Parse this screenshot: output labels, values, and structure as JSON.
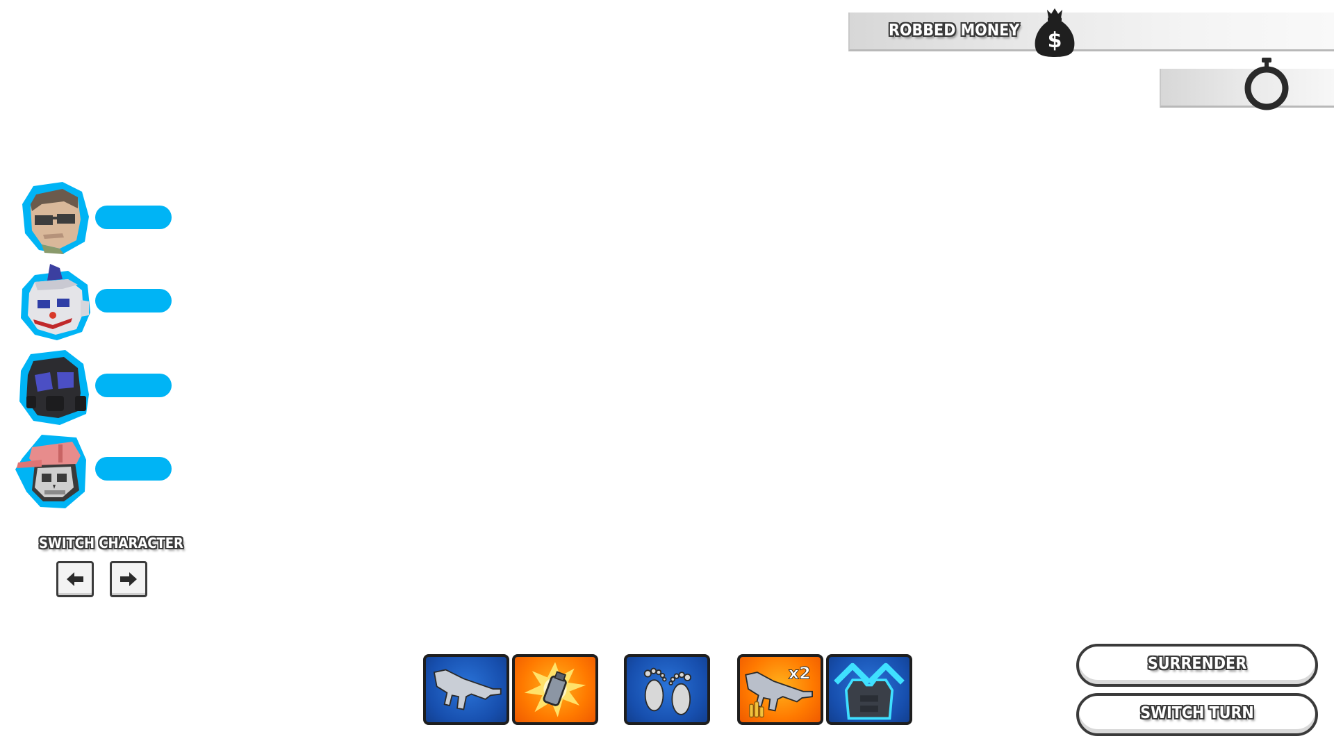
{
  "hud": {
    "money_label": "ROBBED MONEY",
    "money_icon": "money-bag-icon",
    "timer_icon": "stopwatch-icon"
  },
  "characters": [
    {
      "name": "character-bald-sunglasses",
      "health_fraction": 1.0
    },
    {
      "name": "character-clown",
      "health_fraction": 1.0
    },
    {
      "name": "character-gas-mask",
      "health_fraction": 1.0
    },
    {
      "name": "character-skull-cap",
      "health_fraction": 1.0
    }
  ],
  "switch": {
    "label": "SWITCH CHARACTER",
    "prev_icon": "arrow-left-icon",
    "next_icon": "arrow-right-icon"
  },
  "abilities": [
    {
      "icon": "assault-rifle-icon",
      "color": "#174fae"
    },
    {
      "icon": "grenade-explosion-icon",
      "color": "#ff7a00"
    },
    {
      "icon": "footsteps-icon",
      "color": "#174fae"
    },
    {
      "icon": "double-ammo-icon",
      "badge": "x2",
      "color": "#ff7a00"
    },
    {
      "icon": "armor-vest-icon",
      "color": "#174fae"
    }
  ],
  "buttons": {
    "surrender": "SURRENDER",
    "switch_turn": "SWITCH TURN"
  },
  "colors": {
    "health": "#00b4f5",
    "outline": "#3a3a3a"
  }
}
